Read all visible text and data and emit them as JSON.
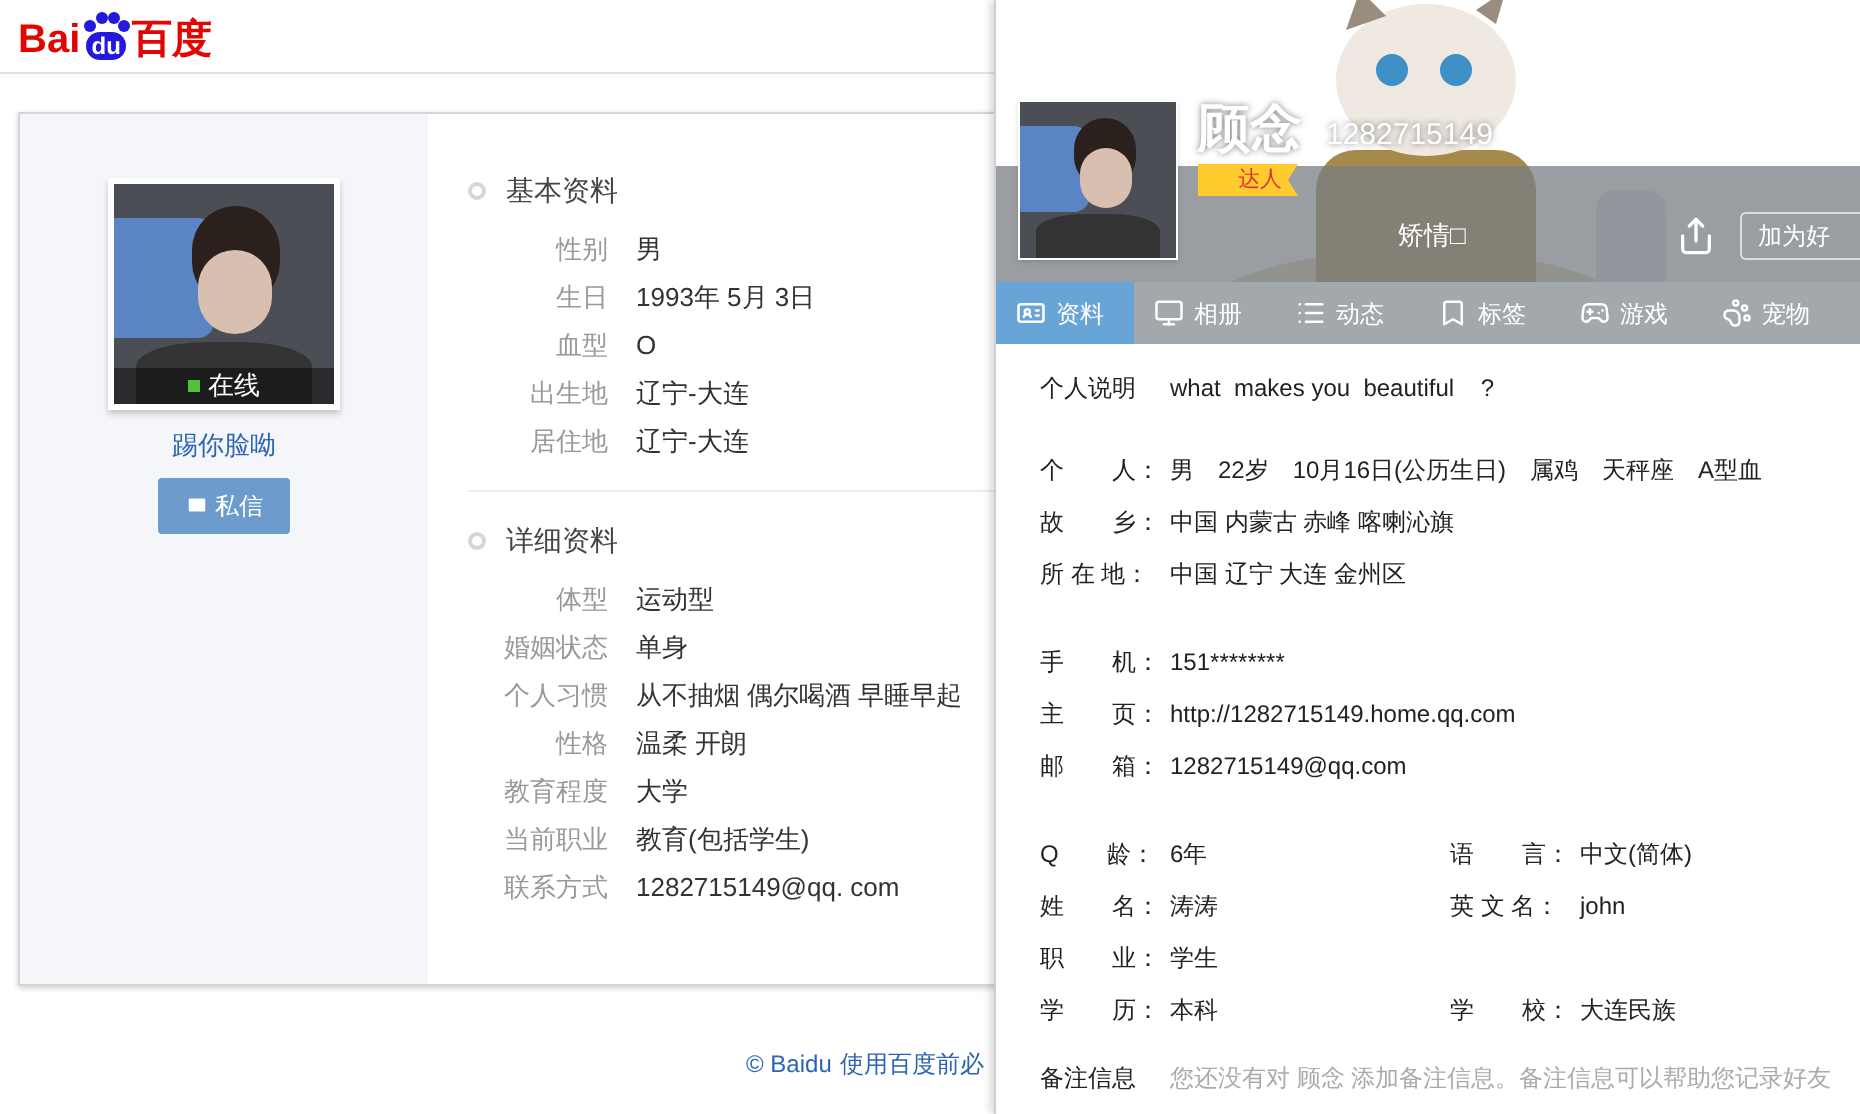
{
  "logo": {
    "latin": "Bai",
    "paw_text": "du",
    "chinese": "百度"
  },
  "profile_card": {
    "online": true,
    "status": "在线",
    "name": "踢你脸呦",
    "message_button": "私信",
    "sections": [
      {
        "title": "基本资料",
        "fields": [
          {
            "label": "性别",
            "value": "男"
          },
          {
            "label": "生日",
            "value": "1993年 5月 3日"
          },
          {
            "label": "血型",
            "value": "O"
          },
          {
            "label": "出生地",
            "value": "辽宁-大连"
          },
          {
            "label": "居住地",
            "value": "辽宁-大连"
          }
        ]
      },
      {
        "title": "详细资料",
        "fields": [
          {
            "label": "体型",
            "value": "运动型"
          },
          {
            "label": "婚姻状态",
            "value": "单身"
          },
          {
            "label": "个人习惯",
            "value": "从不抽烟 偶尔喝酒 早睡早起"
          },
          {
            "label": "性格",
            "value": "温柔 开朗"
          },
          {
            "label": "教育程度",
            "value": "大学"
          },
          {
            "label": "当前职业",
            "value": "教育(包括学生)"
          },
          {
            "label": "联系方式",
            "value": "1282715149@qq. com"
          }
        ]
      }
    ]
  },
  "footer": {
    "copyright": "© Baidu",
    "link": "使用百度前必"
  },
  "qq_panel": {
    "nickname": "顾念",
    "qq_number": "1282715149",
    "badge": "达人",
    "signature": "矫情□",
    "add_friend_button": "加为好",
    "tabs": [
      {
        "label": "资料",
        "kind": "card",
        "selected": true
      },
      {
        "label": "相册",
        "kind": "album",
        "selected": false
      },
      {
        "label": "动态",
        "kind": "feed",
        "selected": false
      },
      {
        "label": "标签",
        "kind": "tag",
        "selected": false
      },
      {
        "label": "游戏",
        "kind": "game",
        "selected": false
      },
      {
        "label": "宠物",
        "kind": "pet",
        "selected": false
      }
    ],
    "intro": {
      "label": "个人说明",
      "value": "what  makes you  beautiful    ?"
    },
    "groups": [
      [
        {
          "label": "个　　人：",
          "value": "男　22岁　10月16日(公历生日)　属鸡　天秤座　A型血"
        },
        {
          "label": "故　　乡：",
          "value": "中国 内蒙古 赤峰 喀喇沁旗"
        },
        {
          "label": "所 在 地：",
          "value": "中国 辽宁 大连 金州区"
        }
      ],
      [
        {
          "label": "手　　机：",
          "value": "151********"
        },
        {
          "label": "主　　页：",
          "value": "http://1282715149.home.qq.com"
        },
        {
          "label": "邮　　箱：",
          "value": "1282715149@qq.com"
        }
      ],
      [
        {
          "label": "Q　　龄：",
          "value": "6年",
          "label_2": "语　　言：",
          "value_2": "中文(简体)"
        },
        {
          "label": "姓　　名：",
          "value": "涛涛",
          "label_2": "英 文 名：",
          "value_2": "john"
        },
        {
          "label": "职　　业：",
          "value": "学生"
        },
        {
          "label": "学　　历：",
          "value": "本科",
          "label_2": "学　　校：",
          "value_2": "大连民族"
        }
      ]
    ],
    "remark": {
      "label": "备注信息",
      "value": "您还没有对 顾念 添加备注信息。备注信息可以帮助您记录好友"
    }
  }
}
